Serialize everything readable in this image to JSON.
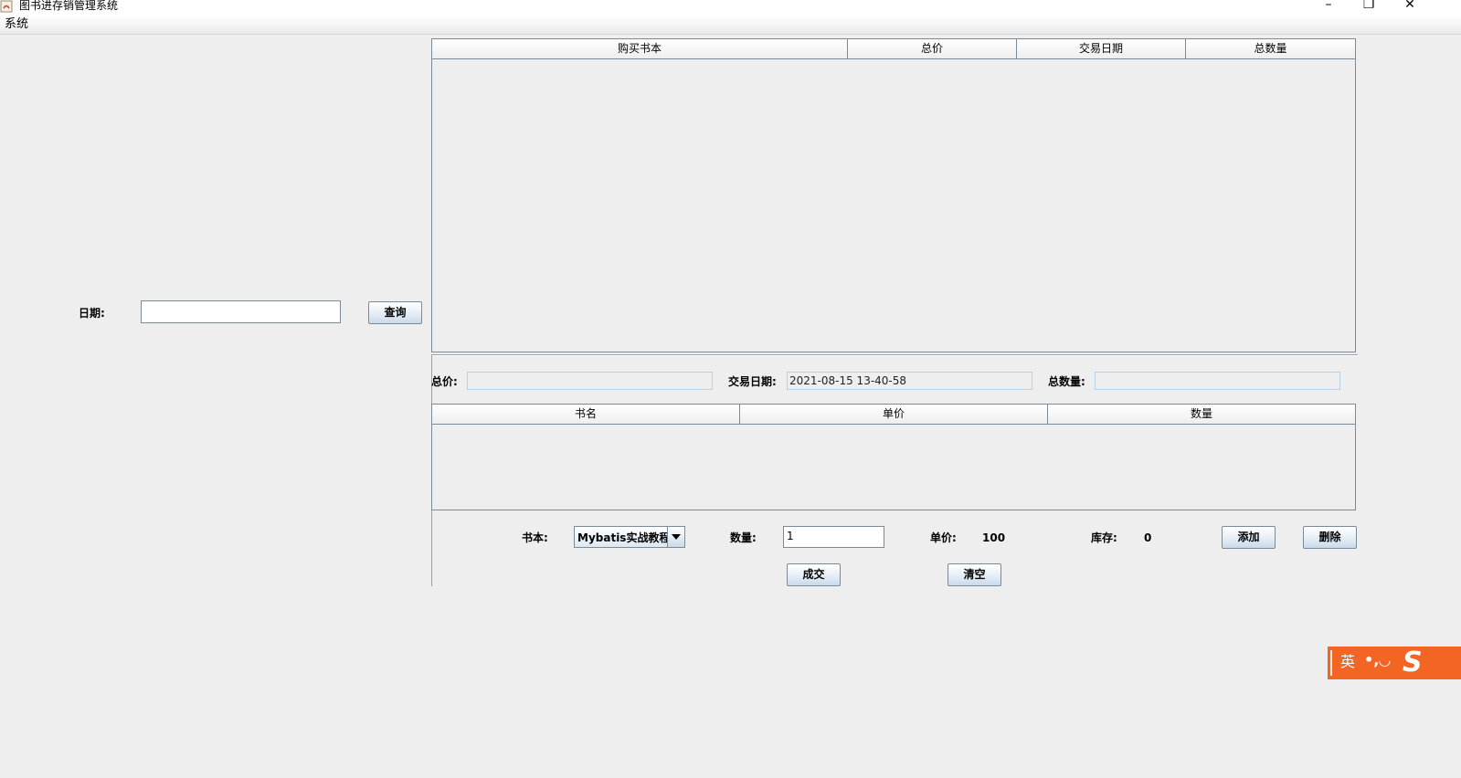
{
  "window": {
    "title": "图书进存销管理系统",
    "controls": {
      "minimize": "–",
      "maximize": "❐",
      "close": "✕"
    }
  },
  "menu": {
    "items": [
      {
        "label": "系统"
      }
    ]
  },
  "query": {
    "date_label": "日期:",
    "date_value": "",
    "query_button": "查询"
  },
  "orders_table": {
    "columns": [
      "购买书本",
      "总价",
      "交易日期",
      "总数量"
    ],
    "rows": []
  },
  "summary": {
    "total_price_label": "总价:",
    "total_price_value": "",
    "trade_date_label": "交易日期:",
    "trade_date_value": "2021-08-15 13-40-58",
    "total_qty_label": "总数量:",
    "total_qty_value": ""
  },
  "items_table": {
    "columns": [
      "书名",
      "单价",
      "数量"
    ],
    "rows": []
  },
  "entry": {
    "book_label": "书本:",
    "book_selected": "Mybatis实战教程",
    "qty_label": "数量:",
    "qty_value": "1",
    "unit_price_label": "单价:",
    "unit_price_value": "100",
    "stock_label": "库存:",
    "stock_value": "0",
    "add_button": "添加",
    "delete_button": "删除",
    "deal_button": "成交",
    "clear_button": "清空"
  },
  "ime": {
    "lang": "英",
    "punct": "•,◡",
    "logo": "S",
    "color": "#f26522"
  }
}
